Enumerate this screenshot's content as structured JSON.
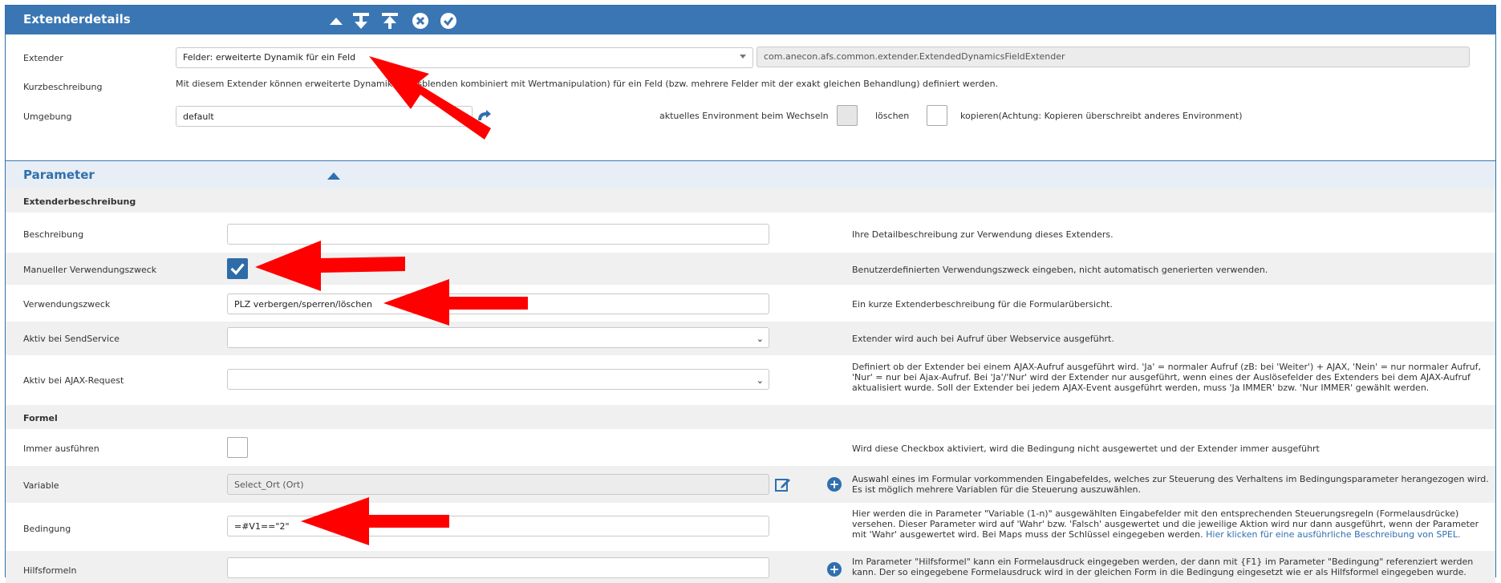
{
  "header": {
    "title": "Extenderdetails"
  },
  "top": {
    "extender_label": "Extender",
    "extender_value": "Felder: erweiterte Dynamik für ein Feld",
    "extender_class": "com.anecon.afs.common.extender.ExtendedDynamicsFieldExtender",
    "kurz_label": "Kurzbeschreibung",
    "kurz_text": "Mit diesem Extender können erweiterte Dynamik ... ausblenden kombiniert mit Wertmanipulation) für ein Feld (bzw. mehrere Felder mit der exakt gleichen Behandlung) definiert werden.",
    "umgebung_label": "Umgebung",
    "umgebung_value": "default",
    "env_text": "aktuelles Environment beim Wechseln",
    "loeschen": "löschen",
    "kopieren": "kopieren(Achtung: Kopieren überschreibt anderes Environment)"
  },
  "parameter": {
    "title": "Parameter",
    "groups": {
      "extenderbeschreibung": "Extenderbeschreibung",
      "formel": "Formel"
    },
    "beschreibung": {
      "label": "Beschreibung",
      "value": "",
      "hint": "Ihre Detailbeschreibung zur Verwendung dieses Extenders."
    },
    "manuell": {
      "label": "Manueller Verwendungszweck",
      "hint": "Benutzerdefinierten Verwendungszweck eingeben, nicht automatisch generierten verwenden."
    },
    "verwendungszweck": {
      "label": "Verwendungszweck",
      "value": "PLZ verbergen/sperren/löschen",
      "hint": "Ein kurze Extenderbeschreibung für die Formularübersicht."
    },
    "sendservice": {
      "label": "Aktiv bei SendService",
      "value": "",
      "hint": "Extender wird auch bei Aufruf über Webservice ausgeführt."
    },
    "ajax": {
      "label": "Aktiv bei AJAX-Request",
      "value": "",
      "hint": "Definiert ob der Extender bei einem AJAX-Aufruf ausgeführt wird. 'Ja' = normaler Aufruf (zB: bei 'Weiter') + AJAX, 'Nein' = nur normaler Aufruf, 'Nur' = nur bei Ajax-Aufruf. Bei 'Ja'/'Nur' wird der Extender nur ausgeführt, wenn eines der Auslösefelder des Extenders bei dem AJAX-Aufruf aktualisiert wurde. Soll der Extender bei jedem AJAX-Event ausgeführt werden, muss 'Ja IMMER' bzw. 'Nur IMMER' gewählt werden."
    },
    "immer": {
      "label": "Immer ausführen",
      "hint": "Wird diese Checkbox aktiviert, wird die Bedingung nicht ausgewertet und der Extender immer ausgeführt"
    },
    "variable": {
      "label": "Variable",
      "value": "Select_Ort (Ort)",
      "hint": "Auswahl eines im Formular vorkommenden Eingabefeldes, welches zur Steuerung des Verhaltens im Bedingungsparameter herangezogen wird. Es ist möglich mehrere Variablen für die Steuerung auszuwählen."
    },
    "bedingung": {
      "label": "Bedingung",
      "value": "=#V1==\"2\"",
      "hint": "Hier werden die in Parameter \"Variable (1-n)\" ausgewählten Eingabefelder mit den entsprechenden Steuerungsregeln (Formelausdrücke) versehen. Dieser Parameter wird auf 'Wahr' bzw. 'Falsch' ausgewertet und die jeweilige Aktion wird nur dann ausgeführt, wenn der Parameter mit 'Wahr' ausgewertet wird. Bei Maps muss der Schlüssel eingegeben werden.",
      "link": "Hier klicken für eine ausführliche Beschreibung von SPEL."
    },
    "hilfsformeln": {
      "label": "Hilfsformeln",
      "value": "",
      "hint": "Im Parameter \"Hilfsformel\" kann ein Formelausdruck eingegeben werden, der dann mit {F1} im Parameter \"Bedingung\" referenziert werden kann. Der so eingegebene Formelausdruck wird in der gleichen Form in die Bedingung eingesetzt wie er als Hilfsformel eingegeben wurde."
    }
  },
  "colors": {
    "accent": "#3a76b3",
    "annotation": "#ff0000"
  }
}
